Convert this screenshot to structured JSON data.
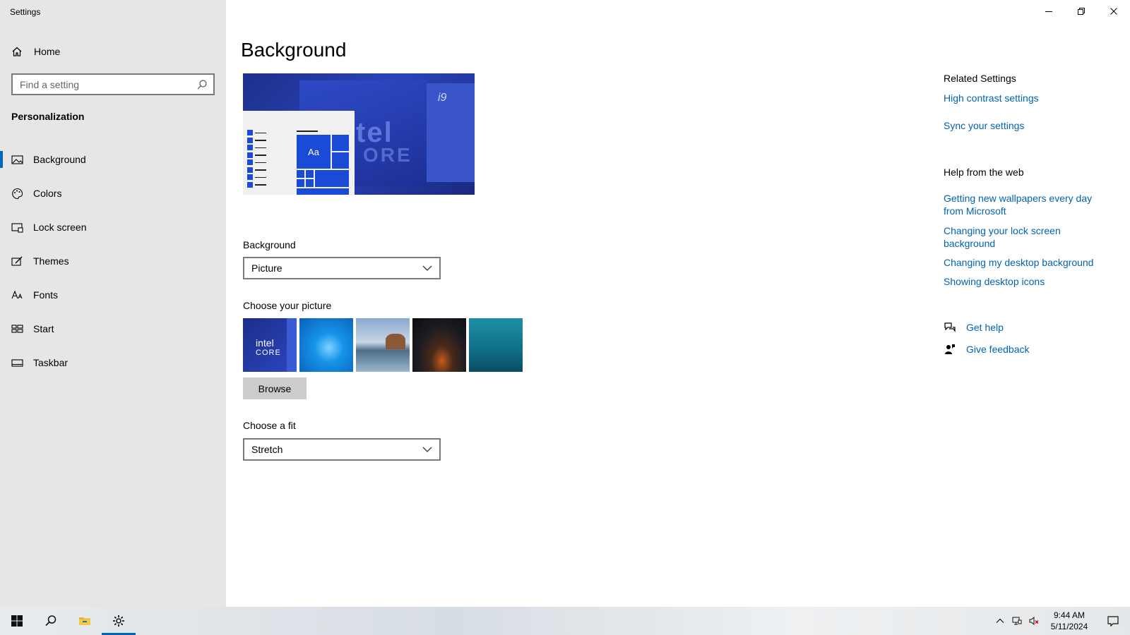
{
  "window": {
    "title": "Settings"
  },
  "sidebar": {
    "home_label": "Home",
    "search_placeholder": "Find a setting",
    "section": "Personalization",
    "items": [
      {
        "label": "Background",
        "icon": "picture-icon"
      },
      {
        "label": "Colors",
        "icon": "palette-icon"
      },
      {
        "label": "Lock screen",
        "icon": "lock-screen-icon"
      },
      {
        "label": "Themes",
        "icon": "themes-icon"
      },
      {
        "label": "Fonts",
        "icon": "fonts-icon"
      },
      {
        "label": "Start",
        "icon": "start-icon"
      },
      {
        "label": "Taskbar",
        "icon": "taskbar-icon"
      }
    ],
    "active_item": "Background"
  },
  "main": {
    "title": "Background",
    "preview": {
      "tile_label": "Aa",
      "wallpaper_text_1": "tel",
      "wallpaper_text_2": "ORE",
      "wallpaper_badge": "i9"
    },
    "background_label": "Background",
    "background_value": "Picture",
    "choose_picture_label": "Choose your picture",
    "thumbnails": [
      {
        "name": "intel-core-wallpaper",
        "text": "intel",
        "subtext": "CORE"
      },
      {
        "name": "windows-blue-wallpaper"
      },
      {
        "name": "beach-rocks-wallpaper"
      },
      {
        "name": "night-sky-tent-wallpaper"
      },
      {
        "name": "underwater-swimmer-wallpaper"
      }
    ],
    "browse_label": "Browse",
    "fit_label": "Choose a fit",
    "fit_value": "Stretch"
  },
  "related": {
    "heading": "Related Settings",
    "links": [
      "High contrast settings",
      "Sync your settings"
    ],
    "help_heading": "Help from the web",
    "help_links": [
      "Getting new wallpapers every day from Microsoft",
      "Changing your lock screen background",
      "Changing my desktop background",
      "Showing desktop icons"
    ],
    "get_help": "Get help",
    "give_feedback": "Give feedback"
  },
  "taskbar": {
    "time": "9:44 AM",
    "date": "5/11/2024"
  },
  "colors": {
    "accent": "#0067c0",
    "link": "#0063b1",
    "sidebar_bg": "#e6e6e6"
  }
}
